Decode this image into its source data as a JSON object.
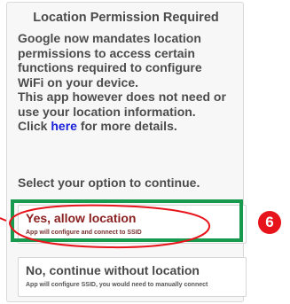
{
  "dialog": {
    "title": "Location Permission Required",
    "body_lines": [
      "Google now mandates location",
      "permissions to access certain",
      "functions required to configure",
      "WiFi on your device.",
      "This app however does not need or",
      "use your location information."
    ],
    "click_prefix": "Click ",
    "link_label": "here",
    "click_suffix": " for more details.",
    "select_prompt": "Select your option to continue."
  },
  "options": {
    "yes": {
      "label": "Yes, allow location",
      "description": "App will configure and connect to SSID"
    },
    "no": {
      "label": "No, continue without location",
      "description": "App will configure SSID, you would need to manually connect"
    }
  },
  "annotation": {
    "step_number": "6",
    "highlight_color": "#179a4e",
    "badge_color": "#e8141c",
    "ellipse_color": "#e8141c"
  }
}
